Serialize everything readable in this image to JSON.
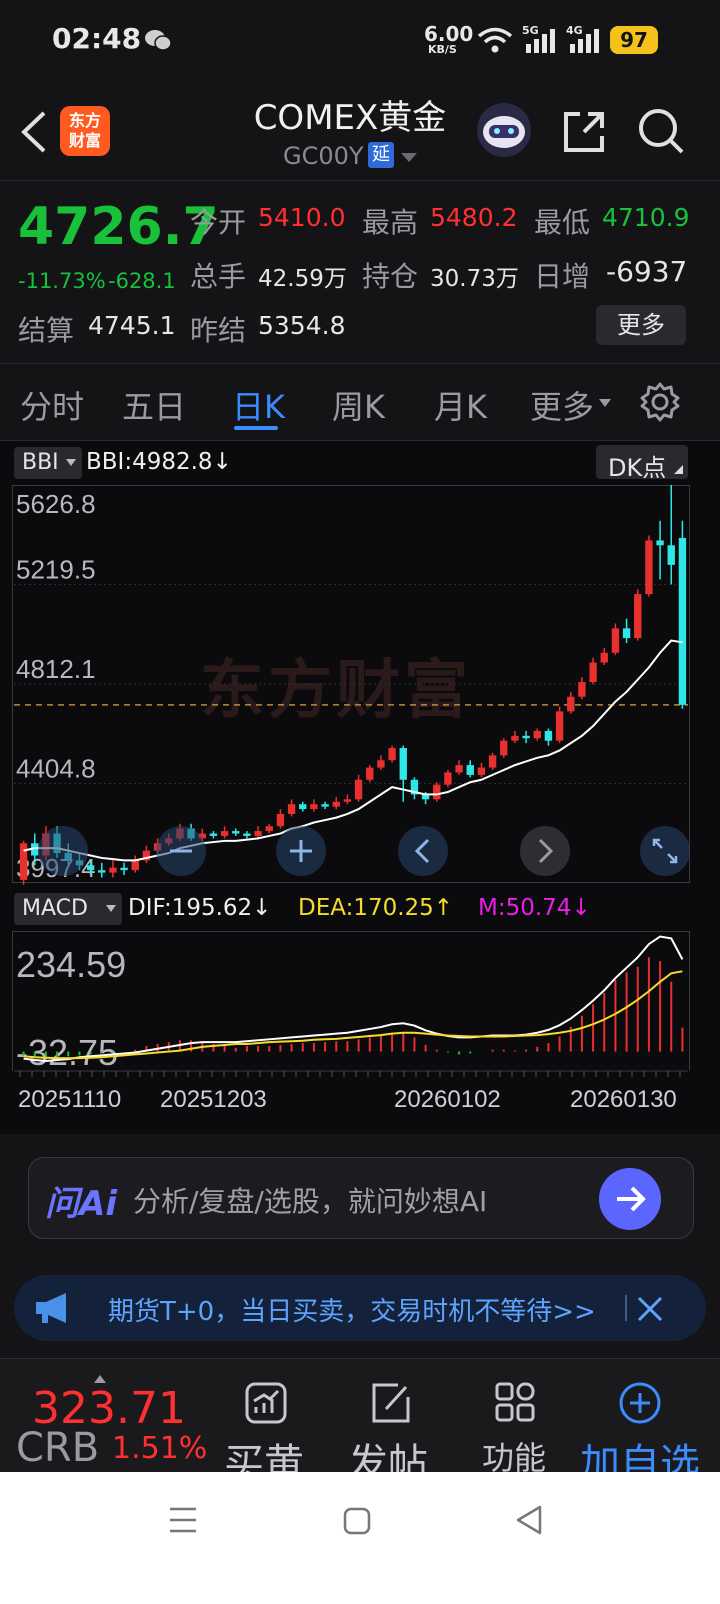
{
  "status": {
    "time": "02:48",
    "speed_value": "6.00",
    "speed_unit": "KB/S",
    "net1": "5G",
    "net2": "4G",
    "battery": "97"
  },
  "nav": {
    "logo_text_1": "东方",
    "logo_text_2": "财富",
    "title": "COMEX黄金",
    "code": "GC00Y",
    "delay_badge": "延"
  },
  "quote": {
    "price": "4726.7",
    "change_pct": "-11.73%",
    "change_amt": "-628.1",
    "open_label": "今开",
    "open_val": "5410.0",
    "high_label": "最高",
    "high_val": "5480.2",
    "low_label": "最低",
    "low_val": "4710.9",
    "vol_label": "总手",
    "vol_val": "42.59万",
    "oi_label": "持仓",
    "oi_val": "30.73万",
    "daily_label": "日增",
    "daily_val": "-6937",
    "settle_label": "结算",
    "settle_val": "4745.1",
    "prev_label": "昨结",
    "prev_val": "5354.8",
    "more_btn": "更多"
  },
  "tabs": [
    "分时",
    "五日",
    "日K",
    "周K",
    "月K",
    "更多"
  ],
  "active_tab": 2,
  "chart_header": {
    "indicator_btn": "BBI",
    "bbi_text": "BBI:4982.8↓",
    "dk_btn": "DK点"
  },
  "macd_header": {
    "btn": "MACD",
    "dif": "DIF:195.62↓",
    "dea": "DEA:170.25↑",
    "m": "M:50.74↓"
  },
  "watermark": "东方财富",
  "chart_data": {
    "type": "candlestick",
    "y_ticks": [
      "5626.8",
      "5219.5",
      "4812.1",
      "4404.8",
      "3997.4"
    ],
    "ylim": [
      3997.4,
      5626.8
    ],
    "last_price_line": 4726.7,
    "candles": [
      [
        4010,
        4160,
        3990,
        4170
      ],
      [
        4160,
        4110,
        4070,
        4200
      ],
      [
        4110,
        4200,
        4090,
        4230
      ],
      [
        4200,
        4120,
        4100,
        4230
      ],
      [
        4120,
        4090,
        4060,
        4160
      ],
      [
        4090,
        4070,
        4050,
        4120
      ],
      [
        4070,
        4050,
        4030,
        4090
      ],
      [
        4050,
        4040,
        4020,
        4080
      ],
      [
        4040,
        4060,
        4020,
        4090
      ],
      [
        4060,
        4050,
        4030,
        4080
      ],
      [
        4050,
        4090,
        4040,
        4110
      ],
      [
        4090,
        4130,
        4080,
        4150
      ],
      [
        4130,
        4160,
        4120,
        4180
      ],
      [
        4160,
        4180,
        4150,
        4200
      ],
      [
        4180,
        4220,
        4170,
        4240
      ],
      [
        4220,
        4180,
        4170,
        4240
      ],
      [
        4180,
        4200,
        4170,
        4220
      ],
      [
        4200,
        4190,
        4180,
        4210
      ],
      [
        4190,
        4210,
        4180,
        4230
      ],
      [
        4210,
        4200,
        4190,
        4220
      ],
      [
        4200,
        4190,
        4180,
        4210
      ],
      [
        4190,
        4210,
        4180,
        4230
      ],
      [
        4210,
        4230,
        4200,
        4240
      ],
      [
        4230,
        4280,
        4220,
        4300
      ],
      [
        4280,
        4320,
        4270,
        4340
      ],
      [
        4320,
        4300,
        4290,
        4330
      ],
      [
        4300,
        4320,
        4290,
        4340
      ],
      [
        4320,
        4310,
        4300,
        4330
      ],
      [
        4310,
        4330,
        4300,
        4350
      ],
      [
        4330,
        4340,
        4320,
        4360
      ],
      [
        4340,
        4420,
        4330,
        4440
      ],
      [
        4420,
        4470,
        4410,
        4480
      ],
      [
        4470,
        4500,
        4460,
        4520
      ],
      [
        4500,
        4550,
        4490,
        4560
      ],
      [
        4550,
        4420,
        4330,
        4560
      ],
      [
        4420,
        4360,
        4340,
        4430
      ],
      [
        4360,
        4340,
        4320,
        4370
      ],
      [
        4340,
        4400,
        4330,
        4410
      ],
      [
        4400,
        4450,
        4390,
        4460
      ],
      [
        4450,
        4480,
        4440,
        4500
      ],
      [
        4480,
        4440,
        4430,
        4500
      ],
      [
        4440,
        4470,
        4430,
        4490
      ],
      [
        4470,
        4520,
        4460,
        4530
      ],
      [
        4520,
        4580,
        4510,
        4590
      ],
      [
        4580,
        4600,
        4570,
        4620
      ],
      [
        4600,
        4590,
        4570,
        4620
      ],
      [
        4590,
        4620,
        4580,
        4630
      ],
      [
        4620,
        4580,
        4560,
        4630
      ],
      [
        4580,
        4700,
        4570,
        4720
      ],
      [
        4700,
        4760,
        4690,
        4780
      ],
      [
        4760,
        4820,
        4750,
        4840
      ],
      [
        4820,
        4900,
        4810,
        4920
      ],
      [
        4900,
        4940,
        4890,
        4960
      ],
      [
        4940,
        5040,
        4930,
        5060
      ],
      [
        5040,
        5000,
        4980,
        5080
      ],
      [
        5000,
        5180,
        4990,
        5200
      ],
      [
        5180,
        5400,
        5170,
        5420
      ],
      [
        5400,
        5380,
        5240,
        5480
      ],
      [
        5380,
        5300,
        5220,
        5626.8
      ],
      [
        5410,
        4726.7,
        4710.9,
        5480.2
      ]
    ],
    "bbi": [
      4130,
      4140,
      4140,
      4140,
      4130,
      4120,
      4110,
      4100,
      4095,
      4090,
      4090,
      4100,
      4110,
      4120,
      4140,
      4150,
      4160,
      4165,
      4170,
      4170,
      4175,
      4180,
      4190,
      4200,
      4220,
      4230,
      4245,
      4255,
      4265,
      4280,
      4300,
      4330,
      4360,
      4390,
      4380,
      4370,
      4360,
      4360,
      4370,
      4390,
      4410,
      4420,
      4440,
      4460,
      4480,
      4495,
      4510,
      4520,
      4540,
      4570,
      4600,
      4640,
      4690,
      4740,
      4780,
      4830,
      4880,
      4940,
      4990,
      4982.8
    ],
    "macd": {
      "y_ticks": [
        "234.59",
        "-32.75"
      ],
      "ylim": [
        -32.75,
        234.59
      ],
      "x_labels": [
        "20251110",
        "20251203",
        "20260102",
        "20260130"
      ],
      "dif": [
        -15,
        -18,
        -20,
        -18,
        -16,
        -12,
        -10,
        -8,
        -6,
        -4,
        -2,
        2,
        6,
        10,
        14,
        18,
        20,
        20,
        20,
        20,
        22,
        24,
        26,
        28,
        30,
        32,
        34,
        36,
        38,
        40,
        44,
        48,
        52,
        58,
        60,
        55,
        45,
        38,
        33,
        30,
        30,
        32,
        34,
        34,
        34,
        36,
        40,
        46,
        56,
        70,
        88,
        108,
        130,
        156,
        178,
        200,
        228,
        244,
        240,
        195.62
      ],
      "dea": [
        -10,
        -12,
        -13,
        -14,
        -14,
        -14,
        -13,
        -12,
        -10,
        -8,
        -6,
        -4,
        -2,
        0,
        2,
        6,
        10,
        12,
        14,
        16,
        16,
        18,
        20,
        21,
        22,
        23,
        25,
        26,
        27,
        29,
        31,
        33,
        35,
        38,
        40,
        40,
        38,
        36,
        34,
        33,
        32,
        32,
        32,
        32,
        33,
        34,
        35,
        37,
        40,
        44,
        50,
        58,
        68,
        80,
        94,
        110,
        128,
        148,
        166,
        170.25
      ],
      "m": [
        -10,
        -12,
        -14,
        -12,
        -10,
        -8,
        -6,
        -4,
        -2,
        0,
        4,
        12,
        16,
        20,
        24,
        24,
        20,
        16,
        12,
        8,
        12,
        12,
        12,
        14,
        16,
        18,
        18,
        20,
        22,
        22,
        26,
        30,
        34,
        40,
        40,
        30,
        14,
        4,
        -2,
        -6,
        -4,
        0,
        4,
        4,
        2,
        4,
        10,
        18,
        32,
        52,
        76,
        100,
        124,
        152,
        168,
        180,
        200,
        192,
        148,
        50.74
      ]
    }
  },
  "ai_bar": {
    "logo": "问Ai",
    "placeholder": "分析/复盘/选股，就问妙想AI"
  },
  "promo": {
    "text": "期货T+0，当日买卖，交易时机不等待>>"
  },
  "bottom": {
    "index_value": "323.71",
    "index_name": "CRB",
    "index_change": "1.51%",
    "buy_label": "买黄",
    "post_label": "发帖",
    "func_label": "功能",
    "add_label": "加自选"
  }
}
